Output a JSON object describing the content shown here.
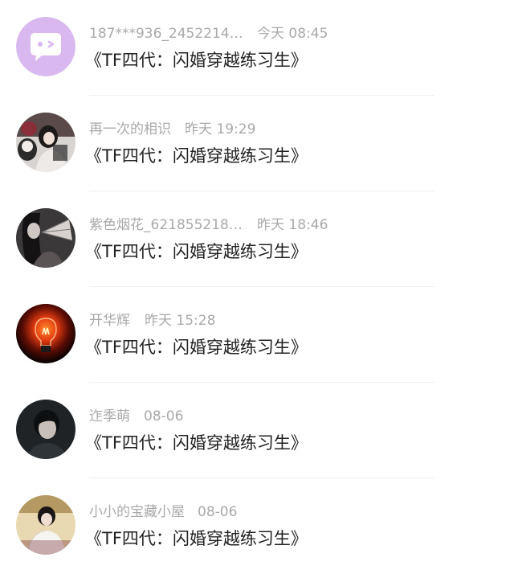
{
  "messages": [
    {
      "avatar_icon": "chat-bubble-wink-icon",
      "avatar_color": "#d9b8f0",
      "name": "187***936_2452214…",
      "time": "今天 08:45",
      "title": "《TF四代：闪婚穿越练习生》"
    },
    {
      "avatar_icon": "girl-with-plush-photo-avatar",
      "name": "再一次的相识",
      "time": "昨天 19:29",
      "title": "《TF四代：闪婚穿越练习生》"
    },
    {
      "avatar_icon": "girl-with-fan-photo-avatar",
      "name": "紫色烟花_621855218…",
      "time": "昨天 18:46",
      "title": "《TF四代：闪婚穿越练习生》"
    },
    {
      "avatar_icon": "light-bulb-photo-avatar",
      "name": "开华辉",
      "time": "昨天 15:28",
      "title": "《TF四代：闪婚穿越练习生》"
    },
    {
      "avatar_icon": "boy-portrait-photo-avatar",
      "name": "迮季萌",
      "time": "08-06",
      "title": "《TF四代：闪婚穿越练习生》"
    },
    {
      "avatar_icon": "boy-white-outfit-photo-avatar",
      "name": "小小的宝藏小屋",
      "time": "08-06",
      "title": "《TF四代：闪婚穿越练习生》"
    }
  ]
}
